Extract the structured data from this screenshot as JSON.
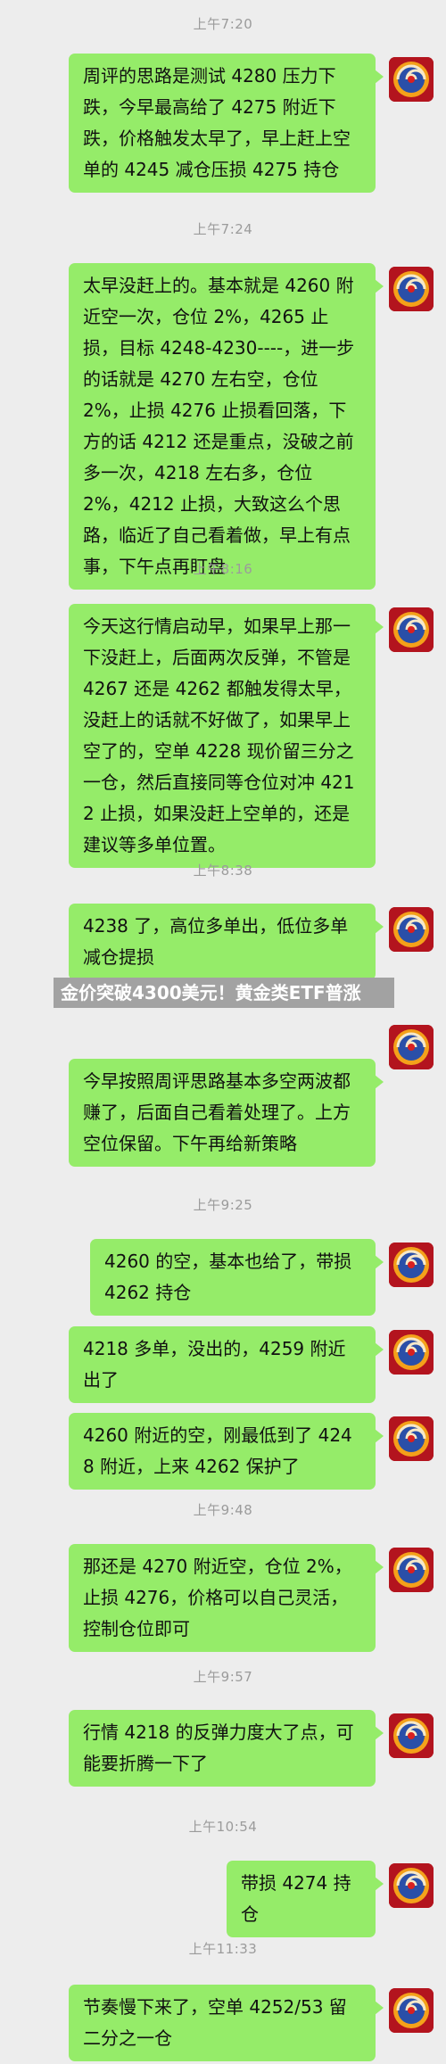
{
  "colors": {
    "background": "#ededed",
    "bubble": "#95ec69",
    "timestamp": "#9b9b9b",
    "banner": "#a2a2a2"
  },
  "avatar_icon": "swirl-logo-icon",
  "messages": [
    {
      "time": "上午7:20",
      "text": "周评的思路是测试 4280 压力下跌，今早最高给了 4275 附近下跌，价格触发太早了，早上赶上空单的 4245 减仓压损 4275 持仓"
    },
    {
      "time": "上午7:24",
      "text": "太早没赶上的。基本就是 4260 附近空一次，仓位 2%，4265 止损，目标 4248-4230----，进一步的话就是 4270 左右空，仓位 2%，止损 4276 止损看回落，下方的话 4212 还是重点，没破之前多一次，4218 左右多，仓位 2%，4212 止损，大致这么个思路，临近了自己看着做，早上有点事，下午点再盯盘"
    },
    {
      "time": "上午8:16",
      "text": "今天这行情启动早，如果早上那一下没赶上，后面两次反弹，不管是 4267 还是 4262 都触发得太早，没赶上的话就不好做了，如果早上空了的，空单 4228 现价留三分之一仓，然后直接同等仓位对冲 4212 止损，如果没赶上空单的，还是建议等多单位置。"
    },
    {
      "time": "上午8:38",
      "text": "4238 了，高位多单出，低位多单减仓提损"
    },
    {
      "time": "",
      "text": "今早按照周评思路基本多空两波都赚了，后面自己看着处理了。上方空位保留。下午再给新策略"
    },
    {
      "time": "上午9:25",
      "text": "4260 的空，基本也给了，带损 4262 持仓"
    },
    {
      "time": "",
      "text": "4218 多单，没出的，4259 附近出了"
    },
    {
      "time": "",
      "text": "4260 附近的空，刚最低到了 4248 附近，上来 4262 保护了"
    },
    {
      "time": "上午9:48",
      "text": "那还是 4270 附近空，仓位 2%，止损 4276，价格可以自己灵活，控制仓位即可"
    },
    {
      "time": "上午9:57",
      "text": "行情 4218 的反弹力度大了点，可能要折腾一下了"
    },
    {
      "time": "上午10:54",
      "text": "带损 4274 持仓"
    },
    {
      "time": "上午11:33",
      "text": "节奏慢下来了，空单 4252/53 留二分之一仓"
    }
  ],
  "banner": {
    "text": "金价突破4300美元！黄金类ETF普涨"
  }
}
